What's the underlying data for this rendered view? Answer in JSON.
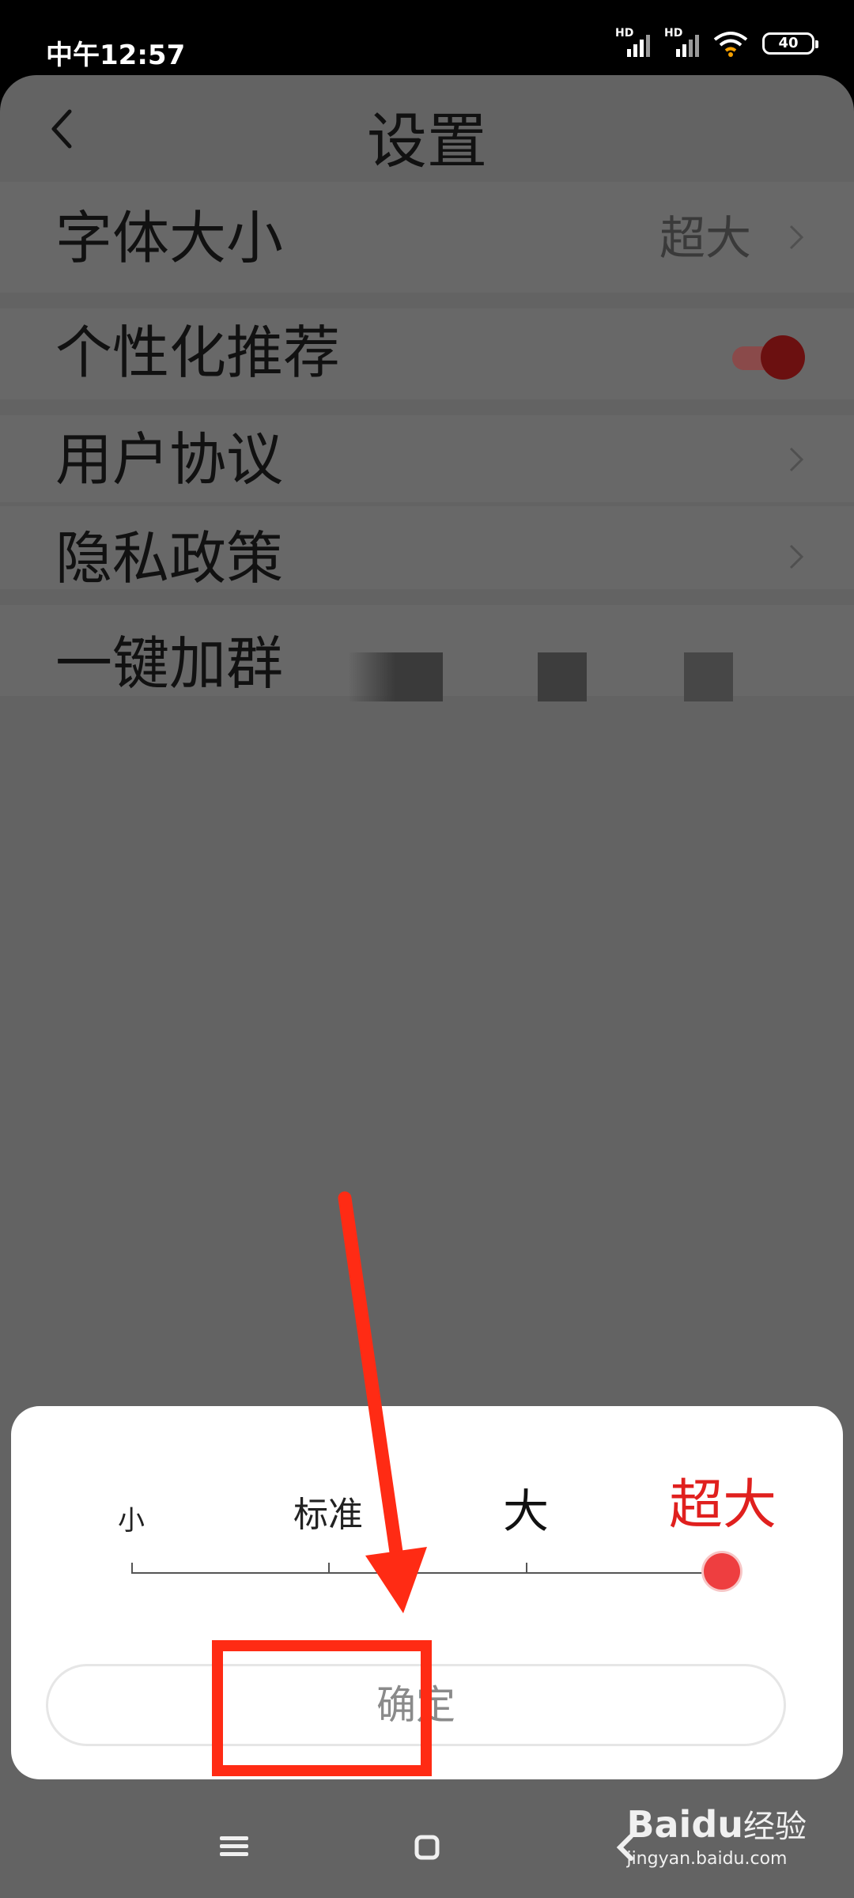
{
  "status_bar": {
    "time": "中午12:57",
    "signal1_label": "HD",
    "signal2_label": "HD",
    "battery": "40"
  },
  "header": {
    "title": "设置"
  },
  "settings": [
    {
      "label": "字体大小",
      "value": "超大"
    },
    {
      "label": "个性化推荐",
      "toggle_on": true
    },
    {
      "label": "用户协议"
    },
    {
      "label": "隐私政策"
    },
    {
      "label": "一键加群"
    }
  ],
  "font_sheet": {
    "options": [
      "小",
      "标准",
      "大",
      "超大"
    ],
    "selected_index": 3,
    "confirm_label": "确定"
  },
  "colors": {
    "accent": "#e0201e",
    "annotation": "#ff2b14",
    "overlay": "#636363"
  },
  "watermark": {
    "brand": "Baidu",
    "brand_cn": "经验",
    "url": "jingyan.baidu.com"
  }
}
